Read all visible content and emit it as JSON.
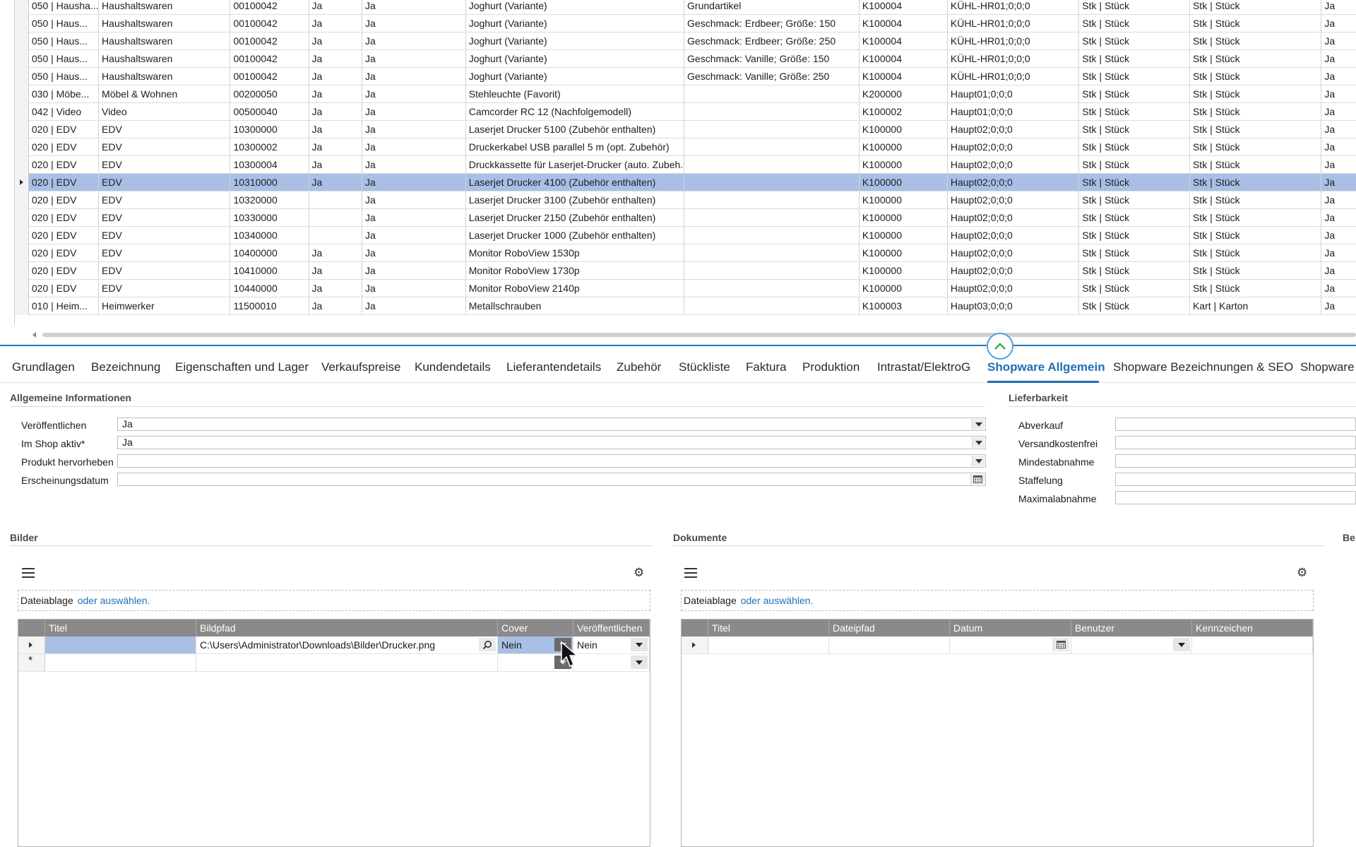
{
  "grid": {
    "rows": [
      {
        "c1": "050 | Hausha...",
        "c2": "Haushaltswaren",
        "c3": "00100042",
        "c4": "Ja",
        "c5": "Ja",
        "c6": "Joghurt (Variante)",
        "c7": "Grundartikel",
        "c8": "K100004",
        "c9": "KÜHL-HR01;0;0;0",
        "c10": "Stk | Stück",
        "c11": "Stk | Stück",
        "c12": "Ja"
      },
      {
        "c1": "050 | Haus...",
        "c2": "Haushaltswaren",
        "c3": "00100042",
        "c4": "Ja",
        "c5": "Ja",
        "c6": "Joghurt (Variante)",
        "c7": "Geschmack: Erdbeer; Größe: 150",
        "c8": "K100004",
        "c9": "KÜHL-HR01;0;0;0",
        "c10": "Stk | Stück",
        "c11": "Stk | Stück",
        "c12": "Ja"
      },
      {
        "c1": "050 | Haus...",
        "c2": "Haushaltswaren",
        "c3": "00100042",
        "c4": "Ja",
        "c5": "Ja",
        "c6": "Joghurt (Variante)",
        "c7": "Geschmack: Erdbeer; Größe: 250",
        "c8": "K100004",
        "c9": "KÜHL-HR01;0;0;0",
        "c10": "Stk | Stück",
        "c11": "Stk | Stück",
        "c12": "Ja"
      },
      {
        "c1": "050 | Haus...",
        "c2": "Haushaltswaren",
        "c3": "00100042",
        "c4": "Ja",
        "c5": "Ja",
        "c6": "Joghurt (Variante)",
        "c7": "Geschmack: Vanille; Größe: 150",
        "c8": "K100004",
        "c9": "KÜHL-HR01;0;0;0",
        "c10": "Stk | Stück",
        "c11": "Stk | Stück",
        "c12": "Ja"
      },
      {
        "c1": "050 | Haus...",
        "c2": "Haushaltswaren",
        "c3": "00100042",
        "c4": "Ja",
        "c5": "Ja",
        "c6": "Joghurt (Variante)",
        "c7": "Geschmack: Vanille; Größe: 250",
        "c8": "K100004",
        "c9": "KÜHL-HR01;0;0;0",
        "c10": "Stk | Stück",
        "c11": "Stk | Stück",
        "c12": "Ja"
      },
      {
        "c1": "030 | Möbe...",
        "c2": "Möbel & Wohnen",
        "c3": "00200050",
        "c4": "Ja",
        "c5": "Ja",
        "c6": "Stehleuchte  (Favorit)",
        "c7": "",
        "c8": "K200000",
        "c9": "Haupt01;0;0;0",
        "c10": "Stk | Stück",
        "c11": "Stk | Stück",
        "c12": "Ja"
      },
      {
        "c1": "042 | Video",
        "c2": "Video",
        "c3": "00500040",
        "c4": "Ja",
        "c5": "Ja",
        "c6": "Camcorder RC 12 (Nachfolgemodell)",
        "c7": "",
        "c8": "K100002",
        "c9": "Haupt01;0;0;0",
        "c10": "Stk | Stück",
        "c11": "Stk | Stück",
        "c12": "Ja"
      },
      {
        "c1": "020 | EDV",
        "c2": "EDV",
        "c3": "10300000",
        "c4": "Ja",
        "c5": "Ja",
        "c6": "Laserjet Drucker 5100 (Zubehör enthalten)",
        "c7": "",
        "c8": "K100000",
        "c9": "Haupt02;0;0;0",
        "c10": "Stk | Stück",
        "c11": "Stk | Stück",
        "c12": "Ja"
      },
      {
        "c1": "020 | EDV",
        "c2": "EDV",
        "c3": "10300002",
        "c4": "Ja",
        "c5": "Ja",
        "c6": "Druckerkabel USB parallel 5 m (opt. Zubehör)",
        "c7": "",
        "c8": "K100000",
        "c9": "Haupt02;0;0;0",
        "c10": "Stk | Stück",
        "c11": "Stk | Stück",
        "c12": "Ja"
      },
      {
        "c1": "020 | EDV",
        "c2": "EDV",
        "c3": "10300004",
        "c4": "Ja",
        "c5": "Ja",
        "c6": "Druckkassette für Laserjet-Drucker (auto. Zubeh...",
        "c7": "",
        "c8": "K100000",
        "c9": "Haupt02;0;0;0",
        "c10": "Stk | Stück",
        "c11": "Stk | Stück",
        "c12": "Ja"
      },
      {
        "c1": "020 | EDV",
        "c2": "EDV",
        "c3": "10310000",
        "c4": "Ja",
        "c5": "Ja",
        "c6": "Laserjet Drucker 4100 (Zubehör enthalten)",
        "c7": "",
        "c8": "K100000",
        "c9": "Haupt02;0;0;0",
        "c10": "Stk | Stück",
        "c11": "Stk | Stück",
        "c12": "Ja",
        "selected": true
      },
      {
        "c1": "020 | EDV",
        "c2": "EDV",
        "c3": "10320000",
        "c4": "",
        "c5": "Ja",
        "c6": "Laserjet Drucker 3100 (Zubehör enthalten)",
        "c7": "",
        "c8": "K100000",
        "c9": "Haupt02;0;0;0",
        "c10": "Stk | Stück",
        "c11": "Stk | Stück",
        "c12": "Ja"
      },
      {
        "c1": "020 | EDV",
        "c2": "EDV",
        "c3": "10330000",
        "c4": "",
        "c5": "Ja",
        "c6": "Laserjet Drucker 2150 (Zubehör enthalten)",
        "c7": "",
        "c8": "K100000",
        "c9": "Haupt02;0;0;0",
        "c10": "Stk | Stück",
        "c11": "Stk | Stück",
        "c12": "Ja"
      },
      {
        "c1": "020 | EDV",
        "c2": "EDV",
        "c3": "10340000",
        "c4": "",
        "c5": "Ja",
        "c6": "Laserjet Drucker 1000 (Zubehör enthalten)",
        "c7": "",
        "c8": "K100000",
        "c9": "Haupt02;0;0;0",
        "c10": "Stk | Stück",
        "c11": "Stk | Stück",
        "c12": "Ja"
      },
      {
        "c1": "020 | EDV",
        "c2": "EDV",
        "c3": "10400000",
        "c4": "Ja",
        "c5": "Ja",
        "c6": "Monitor RoboView 1530p",
        "c7": "",
        "c8": "K100000",
        "c9": "Haupt02;0;0;0",
        "c10": "Stk | Stück",
        "c11": "Stk | Stück",
        "c12": "Ja"
      },
      {
        "c1": "020 | EDV",
        "c2": "EDV",
        "c3": "10410000",
        "c4": "Ja",
        "c5": "Ja",
        "c6": "Monitor RoboView 1730p",
        "c7": "",
        "c8": "K100000",
        "c9": "Haupt02;0;0;0",
        "c10": "Stk | Stück",
        "c11": "Stk | Stück",
        "c12": "Ja"
      },
      {
        "c1": "020 | EDV",
        "c2": "EDV",
        "c3": "10440000",
        "c4": "Ja",
        "c5": "Ja",
        "c6": "Monitor RoboView 2140p",
        "c7": "",
        "c8": "K100000",
        "c9": "Haupt02;0;0;0",
        "c10": "Stk | Stück",
        "c11": "Stk | Stück",
        "c12": "Ja"
      },
      {
        "c1": "010 | Heim...",
        "c2": "Heimwerker",
        "c3": "11500010",
        "c4": "Ja",
        "c5": "Ja",
        "c6": "Metallschrauben",
        "c7": "",
        "c8": "K100003",
        "c9": "Haupt03;0;0;0",
        "c10": "Stk | Stück",
        "c11": "Kart | Karton",
        "c12": "Ja"
      }
    ]
  },
  "tabs": [
    "Grundlagen",
    "Bezeichnung",
    "Eigenschaften und Lager",
    "Verkaufspreise",
    "Kundendetails",
    "Lieferantendetails",
    "Zubehör",
    "Stückliste",
    "Faktura",
    "Produktion",
    "Intrastat/ElektroG",
    "Shopware Allgemein",
    "Shopware Bezeichnungen & SEO",
    "Shopware I"
  ],
  "active_tab": "Shopware Allgemein",
  "allgemein": {
    "title": "Allgemeine Informationen",
    "fields": [
      {
        "label": "Veröffentlichen",
        "value": "Ja"
      },
      {
        "label": "Im Shop aktiv*",
        "value": "Ja"
      },
      {
        "label": "Produkt hervorheben",
        "value": ""
      },
      {
        "label": "Erscheinungsdatum",
        "value": ""
      }
    ]
  },
  "lieferbarkeit": {
    "title": "Lieferbarkeit",
    "fields": [
      "Abverkauf",
      "Versandkostenfrei",
      "Mindestabnahme",
      "Staffelung",
      "Maximalabnahme"
    ]
  },
  "bilder": {
    "title": "Bilder",
    "drop_label": "Dateiablage",
    "drop_link": "oder auswählen.",
    "columns": [
      "Titel",
      "Bildpfad",
      "Cover",
      "Veröffentlichen"
    ],
    "row": {
      "titel": "",
      "bildpfad": "C:\\Users\\Administrator\\Downloads\\Bilder\\Drucker.png",
      "cover": "Nein",
      "veroeffentlichen": "Nein"
    }
  },
  "dokumente": {
    "title": "Dokumente",
    "drop_label": "Dateiablage",
    "drop_link": "oder auswählen.",
    "columns": [
      "Titel",
      "Dateipfad",
      "Datum",
      "Benutzer",
      "Kennzeichen"
    ]
  },
  "cut_section": "Be",
  "colors": {
    "selection": "#a9bfe6",
    "accent": "#1f6fb8",
    "splitter": "#1f7ac8",
    "grid_header": "#8a8a8a"
  }
}
